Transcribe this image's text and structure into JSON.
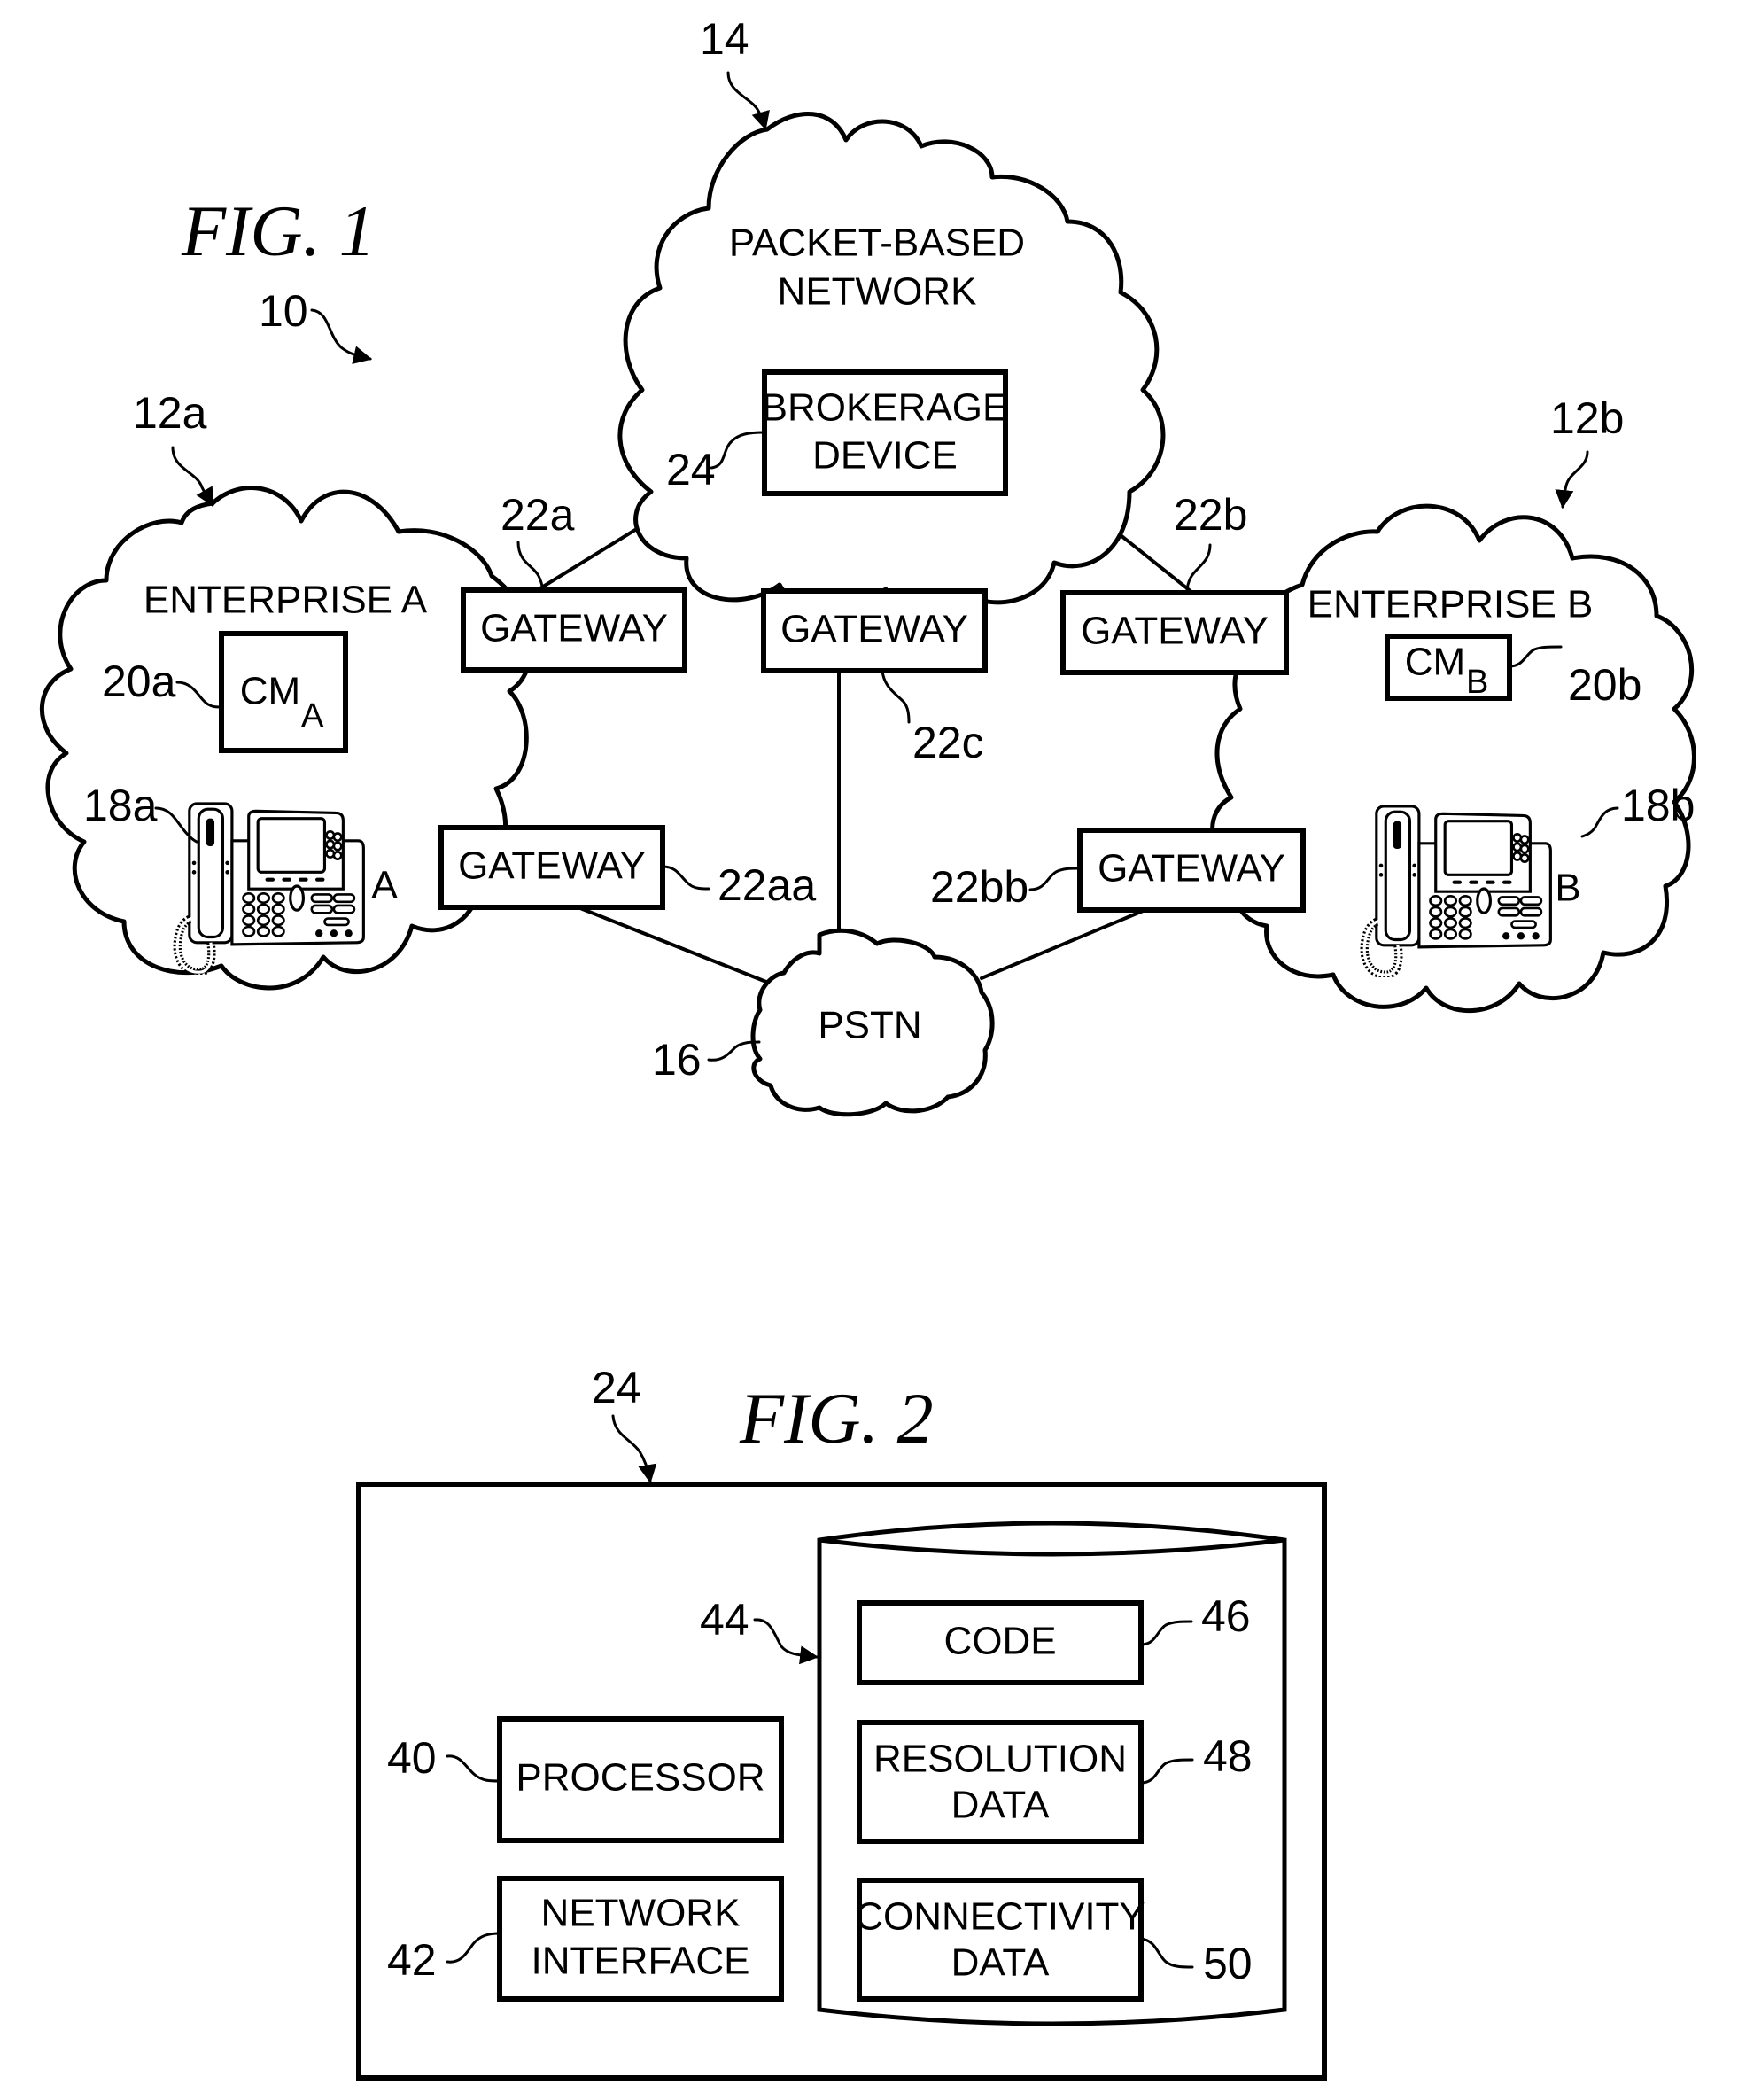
{
  "fig1": {
    "title": "FIG. 1",
    "system_ref": "10",
    "packet_network": {
      "ref": "14",
      "label_line1": "PACKET-BASED",
      "label_line2": "NETWORK",
      "brokerage_device": {
        "ref": "24",
        "label_line1": "BROKERAGE",
        "label_line2": "DEVICE"
      }
    },
    "enterprise_a": {
      "ref": "12a",
      "label": "ENTERPRISE A",
      "call_manager": {
        "ref": "20a",
        "label": "CM",
        "subscript": "A"
      },
      "phone": {
        "ref": "18a",
        "label": "A",
        "icon": "desk-phone-icon"
      }
    },
    "enterprise_b": {
      "ref": "12b",
      "label": "ENTERPRISE B",
      "call_manager": {
        "ref": "20b",
        "label": "CM",
        "subscript": "B"
      },
      "phone": {
        "ref": "18b",
        "label": "B",
        "icon": "desk-phone-icon"
      }
    },
    "gateways": [
      {
        "ref": "22a",
        "label": "GATEWAY"
      },
      {
        "ref": "22c",
        "label": "GATEWAY"
      },
      {
        "ref": "22b",
        "label": "GATEWAY"
      },
      {
        "ref": "22aa",
        "label": "GATEWAY"
      },
      {
        "ref": "22bb",
        "label": "GATEWAY"
      }
    ],
    "pstn": {
      "ref": "16",
      "label": "PSTN"
    }
  },
  "fig2": {
    "title": "FIG. 2",
    "device_ref": "24",
    "processor": {
      "ref": "40",
      "label": "PROCESSOR"
    },
    "network_interface": {
      "ref": "42",
      "label_line1": "NETWORK",
      "label_line2": "INTERFACE"
    },
    "memory": {
      "ref": "44",
      "code": {
        "ref": "46",
        "label": "CODE"
      },
      "resolution_data": {
        "ref": "48",
        "label_line1": "RESOLUTION",
        "label_line2": "DATA"
      },
      "connectivity_data": {
        "ref": "50",
        "label_line1": "CONNECTIVITY",
        "label_line2": "DATA"
      }
    }
  }
}
